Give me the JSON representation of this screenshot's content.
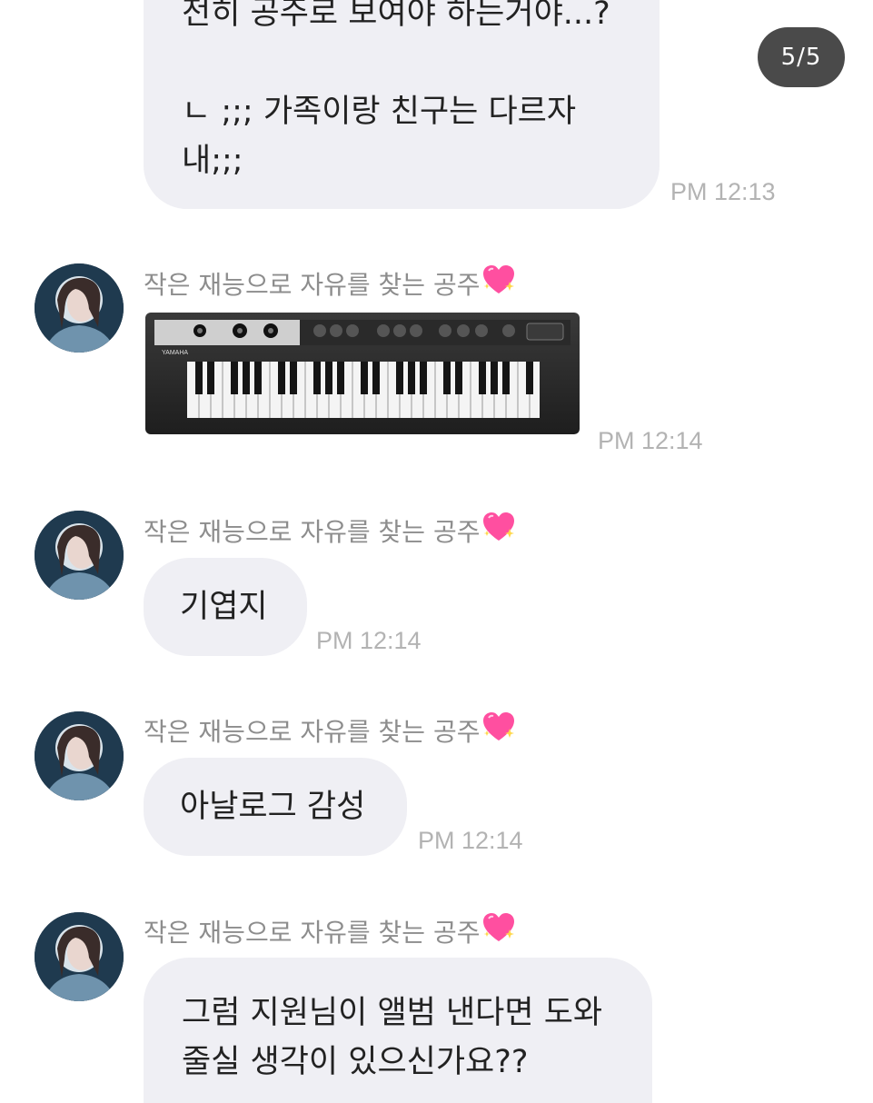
{
  "page_counter": "5/5",
  "sender_name": "작은 재능으로 자유를 찾는 공주",
  "heart_icon": "sparkling-heart-icon",
  "messages": [
    {
      "type": "text",
      "lines": [
        "전히 공주로 보여야 하는거야...?",
        "",
        "ㄴ ;;; 가족이랑 친구는 다르자",
        "내;;;"
      ],
      "time": "PM 12:13"
    },
    {
      "type": "image",
      "image_desc": "keyboard-synthesizer-photo",
      "brand": "YAMAHA",
      "time": "PM 12:14"
    },
    {
      "type": "text",
      "lines": [
        "기엽지"
      ],
      "time": "PM 12:14"
    },
    {
      "type": "text",
      "lines": [
        "아날로그 감성"
      ],
      "time": "PM 12:14"
    },
    {
      "type": "text",
      "lines": [
        "그럼 지원님이 앨범 낸다면 도와",
        "줄실 생각이 있으신가요??"
      ],
      "time": ""
    }
  ],
  "colors": {
    "bubble": "#efeff4",
    "timestamp": "#b3b3b3",
    "counter_bg": "#4a4a4a",
    "heart": "#ff4fa0"
  }
}
